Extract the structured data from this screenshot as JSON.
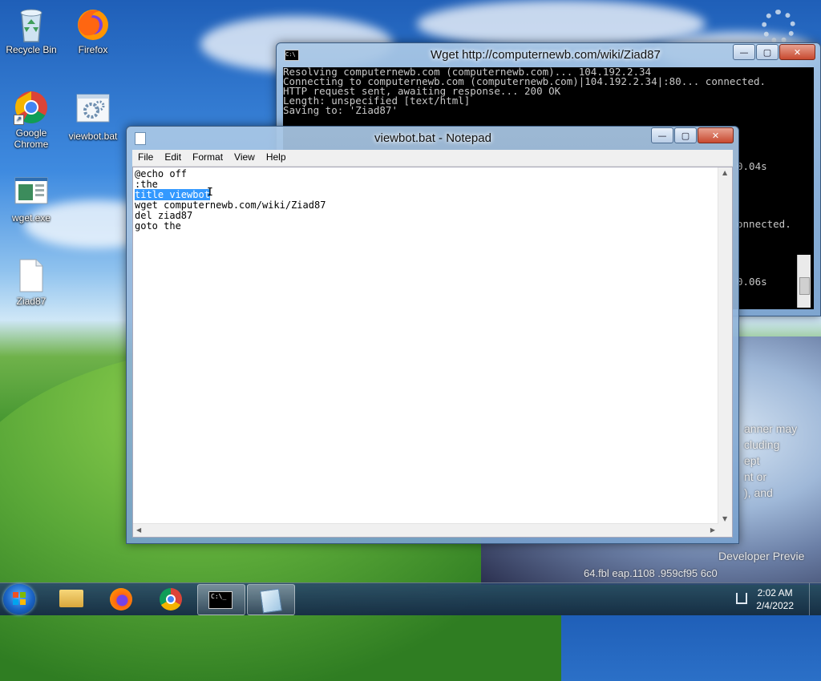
{
  "desktop": {
    "icons": [
      {
        "label": "Recycle Bin"
      },
      {
        "label": "Firefox"
      },
      {
        "label": "Google Chrome"
      },
      {
        "label": "viewbot.bat"
      },
      {
        "label": "wget.exe"
      },
      {
        "label": "Ziad87"
      }
    ],
    "watermark_lines": [
      "anner may",
      "cluding",
      "ept",
      "nt or",
      "), and",
      "Developer Previe",
      "64.fbl  eap.1108        .959cf95      6c0"
    ]
  },
  "cmd_window": {
    "title": "Wget http://computernewb.com/wiki/Ziad87",
    "lines": [
      "Resolving computernewb.com (computernewb.com)... 104.192.2.34",
      "Connecting to computernewb.com (computernewb.com)|104.192.2.34|:80... connected.",
      "",
      "HTTP request sent, awaiting response... 200 OK",
      "Length: unspecified [text/html]",
      "Saving to: 'Ziad87'"
    ],
    "peek_lines": [
      "0.04s",
      "onnected.",
      "0.06s"
    ]
  },
  "notepad": {
    "title": "viewbot.bat - Notepad",
    "menu": [
      "File",
      "Edit",
      "Format",
      "View",
      "Help"
    ],
    "lines": [
      {
        "text": "@echo off",
        "selected": ""
      },
      {
        "text": ":the",
        "selected": ""
      },
      {
        "text": "",
        "selected": "title viewbot"
      },
      {
        "text": "wget computernewb.com/wiki/Ziad87",
        "selected": ""
      },
      {
        "text": "del ziad87",
        "selected": ""
      },
      {
        "text": "goto the",
        "selected": ""
      }
    ]
  },
  "taskbar": {
    "time": "2:02 AM",
    "date": "2/4/2022"
  },
  "colors": {
    "selection": "#3399ff",
    "cmd_bg": "#000000",
    "cmd_text": "#c8c8c8"
  }
}
